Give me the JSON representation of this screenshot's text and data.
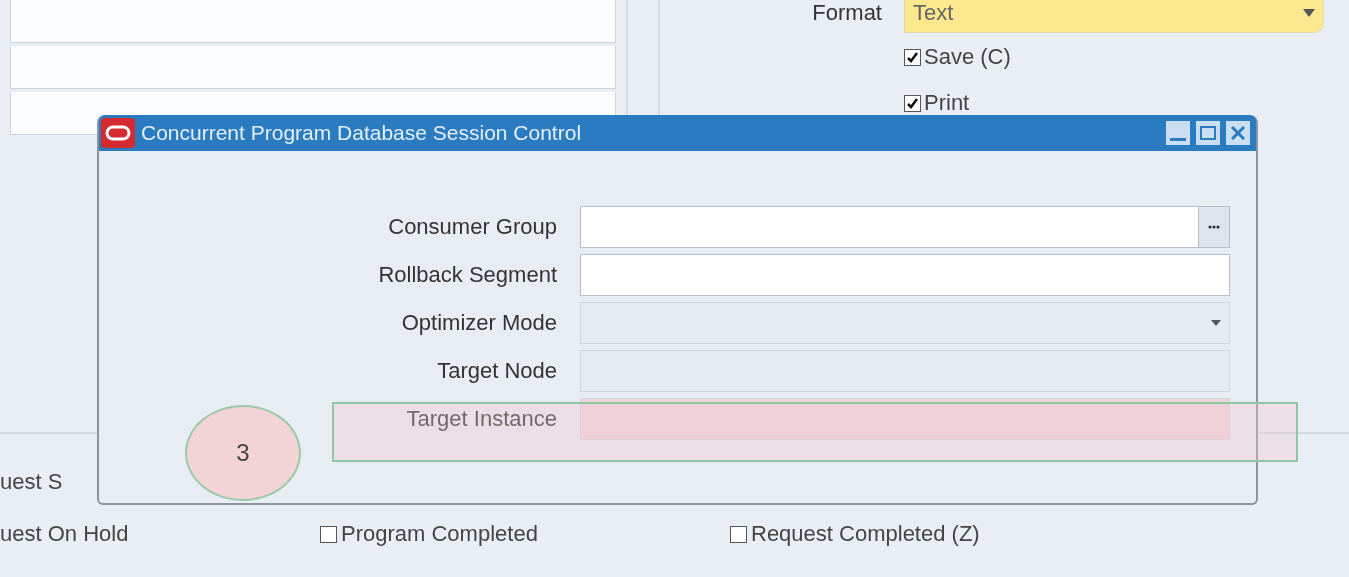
{
  "output": {
    "format_label": "Format",
    "format_value": "Text",
    "options": [
      {
        "label": "Save (C)",
        "checked": true
      },
      {
        "label": "Print",
        "checked": true
      }
    ]
  },
  "dialog": {
    "title": "Concurrent Program Database Session Control",
    "fields": [
      {
        "label": "Consumer Group",
        "kind": "lov",
        "highlighted": false
      },
      {
        "label": "Rollback Segment",
        "kind": "text",
        "highlighted": false
      },
      {
        "label": "Optimizer Mode",
        "kind": "select",
        "highlighted": false
      },
      {
        "label": "Target Node",
        "kind": "readonly",
        "highlighted": false
      },
      {
        "label": "Target Instance",
        "kind": "readonly",
        "highlighted": true
      }
    ]
  },
  "annotation": {
    "number": "3"
  },
  "status_rows": [
    {
      "label": "uest S",
      "checkboxes": []
    },
    {
      "label": "uest On Hold",
      "checkboxes": [
        {
          "label": "Program Completed",
          "checked": false
        },
        {
          "label": "Request Completed (Z)",
          "checked": false
        }
      ]
    }
  ]
}
